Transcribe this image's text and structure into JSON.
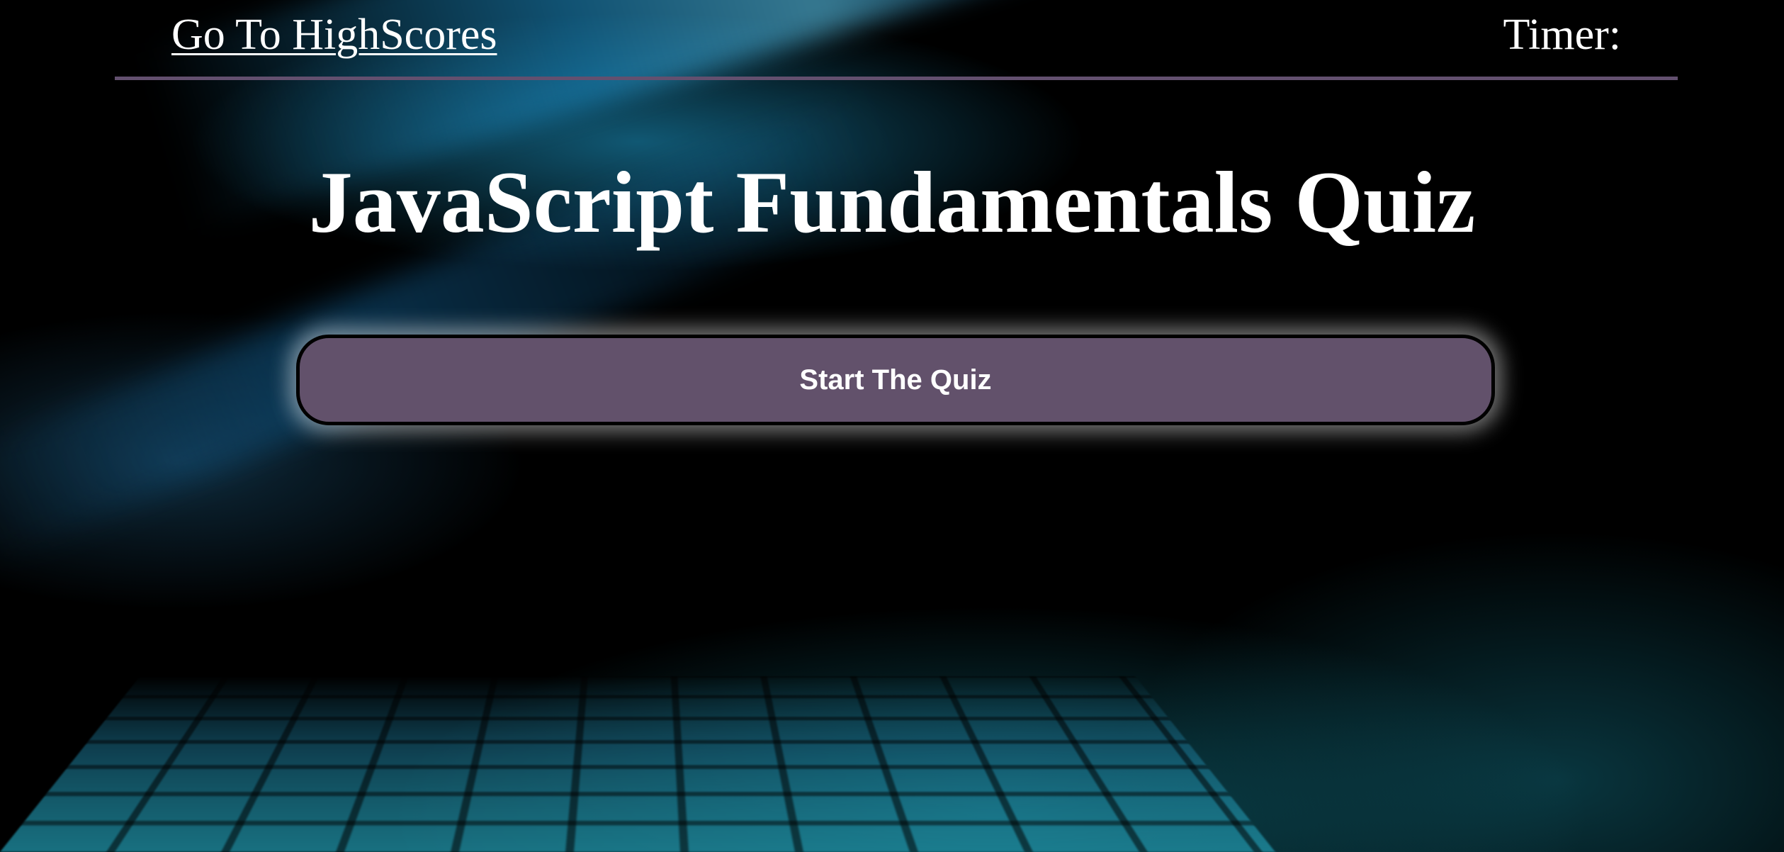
{
  "header": {
    "highscores_link": "Go To HighScores",
    "timer_label": "Timer:"
  },
  "main": {
    "title": "JavaScript Fundamentals Quiz",
    "start_button": "Start The Quiz"
  },
  "colors": {
    "accent": "#62516b",
    "divider": "#63506f",
    "text": "#ffffff"
  }
}
